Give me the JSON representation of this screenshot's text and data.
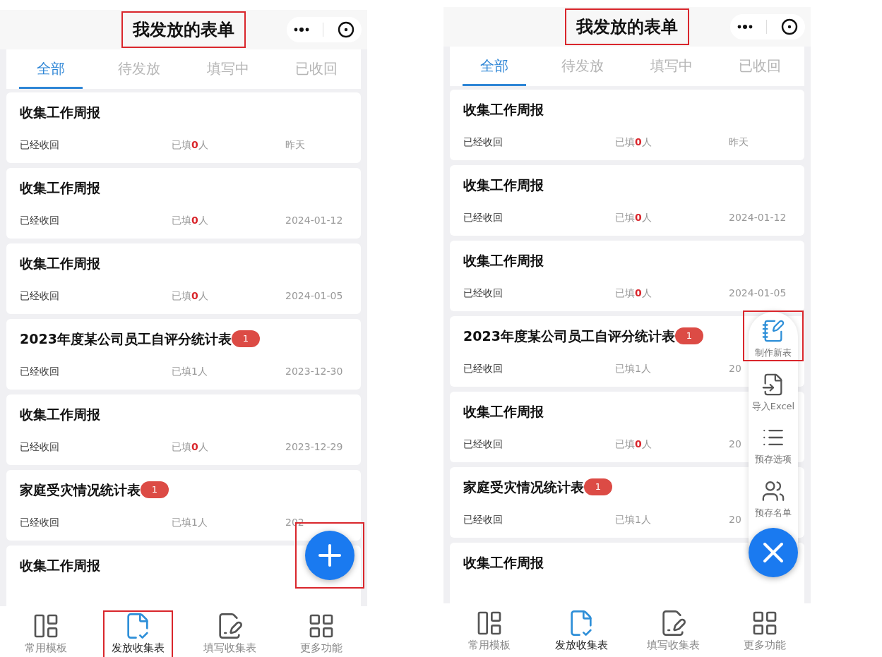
{
  "phones": [
    {
      "title": {
        "text": "我发放的表单",
        "highlight": true
      },
      "tabs": [
        {
          "label": "全部",
          "selected": true
        },
        {
          "label": "待发放",
          "selected": false
        },
        {
          "label": "填写中",
          "selected": false
        },
        {
          "label": "已收回",
          "selected": false
        }
      ],
      "forms": [
        {
          "title": "收集工作周报",
          "status": "已经收回",
          "filled": {
            "prefix": "已填",
            "count": "0",
            "suffix": "人",
            "alert": true
          },
          "date": "昨天"
        },
        {
          "title": "收集工作周报",
          "status": "已经收回",
          "filled": {
            "prefix": "已填",
            "count": "0",
            "suffix": "人",
            "alert": true
          },
          "date": "2024-01-12"
        },
        {
          "title": "收集工作周报",
          "status": "已经收回",
          "filled": {
            "prefix": "已填",
            "count": "0",
            "suffix": "人",
            "alert": true
          },
          "date": "2024-01-05"
        },
        {
          "title": "2023年度某公司员工自评分统计表",
          "badge": "1",
          "status": "已经收回",
          "filled": {
            "prefix": "已填",
            "count": "1",
            "suffix": "人",
            "alert": false
          },
          "date": "2023-12-30"
        },
        {
          "title": "收集工作周报",
          "status": "已经收回",
          "filled": {
            "prefix": "已填",
            "count": "0",
            "suffix": "人",
            "alert": true
          },
          "date": "2023-12-29"
        },
        {
          "title": "家庭受灾情况统计表",
          "badge": "1",
          "status": "已经收回",
          "filled": {
            "prefix": "已填",
            "count": "1",
            "suffix": "人",
            "alert": false
          },
          "date": "202"
        },
        {
          "title": "收集工作周报"
        }
      ],
      "nav": [
        {
          "label": "常用模板",
          "kind": "templates",
          "selected": false,
          "highlight": false
        },
        {
          "label": "发放收集表",
          "kind": "send",
          "selected": true,
          "highlight": true
        },
        {
          "label": "填写收集表",
          "kind": "fill",
          "selected": false,
          "highlight": false
        },
        {
          "label": "更多功能",
          "kind": "more",
          "selected": false,
          "highlight": false
        }
      ],
      "fab": {
        "kind": "add",
        "highlight": true
      }
    },
    {
      "title": {
        "text": "我发放的表单",
        "highlight": true
      },
      "tabs": [
        {
          "label": "全部",
          "selected": true
        },
        {
          "label": "待发放",
          "selected": false
        },
        {
          "label": "填写中",
          "selected": false
        },
        {
          "label": "已收回",
          "selected": false
        }
      ],
      "forms": [
        {
          "title": "收集工作周报",
          "status": "已经收回",
          "filled": {
            "prefix": "已填",
            "count": "0",
            "suffix": "人",
            "alert": true
          },
          "date": "昨天"
        },
        {
          "title": "收集工作周报",
          "status": "已经收回",
          "filled": {
            "prefix": "已填",
            "count": "0",
            "suffix": "人",
            "alert": true
          },
          "date": "2024-01-12"
        },
        {
          "title": "收集工作周报",
          "status": "已经收回",
          "filled": {
            "prefix": "已填",
            "count": "0",
            "suffix": "人",
            "alert": true
          },
          "date": "2024-01-05"
        },
        {
          "title": "2023年度某公司员工自评分统计表",
          "badge": "1",
          "status": "已经收回",
          "filled": {
            "prefix": "已填",
            "count": "1",
            "suffix": "人",
            "alert": false
          },
          "date": "20"
        },
        {
          "title": "收集工作周报",
          "status": "已经收回",
          "filled": {
            "prefix": "已填",
            "count": "0",
            "suffix": "人",
            "alert": true
          },
          "date": "20"
        },
        {
          "title": "家庭受灾情况统计表",
          "badge": "1",
          "status": "已经收回",
          "filled": {
            "prefix": "已填",
            "count": "1",
            "suffix": "人",
            "alert": false
          },
          "date": "20"
        },
        {
          "title": "收集工作周报"
        }
      ],
      "nav": [
        {
          "label": "常用模板",
          "kind": "templates",
          "selected": false,
          "highlight": false
        },
        {
          "label": "发放收集表",
          "kind": "send",
          "selected": true,
          "highlight": false
        },
        {
          "label": "填写收集表",
          "kind": "fill",
          "selected": false,
          "highlight": false
        },
        {
          "label": "更多功能",
          "kind": "more",
          "selected": false,
          "highlight": false
        }
      ],
      "fab": {
        "kind": "close",
        "highlight": false
      },
      "fab_menu": [
        {
          "label": "制作新表",
          "kind": "new",
          "highlight": true
        },
        {
          "label": "导入Excel",
          "kind": "import",
          "highlight": false
        },
        {
          "label": "预存选项",
          "kind": "options",
          "highlight": false
        },
        {
          "label": "预存名单",
          "kind": "roster",
          "highlight": false
        }
      ]
    }
  ]
}
